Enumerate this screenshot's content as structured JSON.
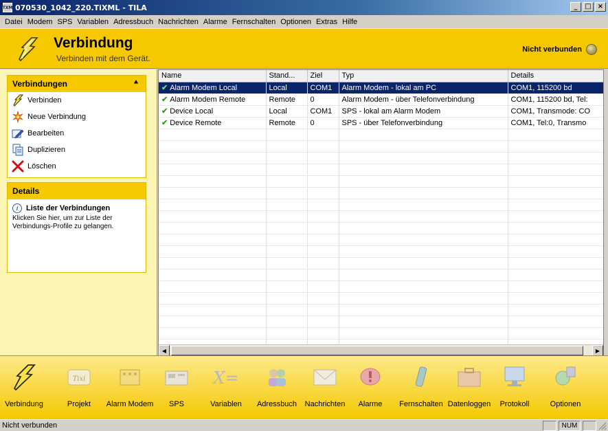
{
  "window": {
    "title": "070530_1042_220.TiXML - TILA",
    "app_icon_text": "TXM"
  },
  "menu": [
    "Datei",
    "Modem",
    "SPS",
    "Variablen",
    "Adressbuch",
    "Nachrichten",
    "Alarme",
    "Fernschalten",
    "Optionen",
    "Extras",
    "Hilfe"
  ],
  "header": {
    "title": "Verbindung",
    "subtitle": "Verbinden mit dem Gerät.",
    "status": "Nicht verbunden"
  },
  "connections_panel": {
    "title": "Verbindungen",
    "items": [
      "Verbinden",
      "Neue Verbindung",
      "Bearbeiten",
      "Duplizieren",
      "Löschen"
    ]
  },
  "details_panel": {
    "title": "Details",
    "info_title": "Liste der Verbindungen",
    "info_text": "Klicken Sie hier, um zur Liste der Verbindungs-Profile zu gelangen."
  },
  "table": {
    "columns": [
      "Name",
      "Stand...",
      "Ziel",
      "Typ",
      "Details"
    ],
    "rows": [
      {
        "name": "Alarm Modem Local",
        "stand": "Local",
        "ziel": "COM1",
        "typ": "Alarm Modem - lokal am PC",
        "details": "COM1, 115200 bd",
        "selected": true
      },
      {
        "name": "Alarm Modem Remote",
        "stand": "Remote",
        "ziel": "0",
        "typ": "Alarm Modem - über Telefonverbindung",
        "details": "COM1, 115200 bd, Tel:",
        "selected": false
      },
      {
        "name": "Device Local",
        "stand": "Local",
        "ziel": "COM1",
        "typ": "SPS - lokal am Alarm Modem",
        "details": "COM1, Transmode: CO",
        "selected": false
      },
      {
        "name": "Device Remote",
        "stand": "Remote",
        "ziel": "0",
        "typ": "SPS - über Telefonverbindung",
        "details": "COM1, Tel:0, Transmo",
        "selected": false
      }
    ]
  },
  "toolbar": {
    "buttons": [
      {
        "label": "Verbindung",
        "icon": "lightning-icon"
      },
      {
        "label": "Projekt",
        "icon": "tixi-device-icon",
        "icon_text": "Tixi"
      },
      {
        "label": "Alarm Modem",
        "icon": "alarm-modem-icon"
      },
      {
        "label": "SPS",
        "icon": "plc-icon"
      },
      {
        "label": "Variablen",
        "icon": "variable-icon",
        "icon_text": "X="
      },
      {
        "label": "Adressbuch",
        "icon": "address-book-icon"
      },
      {
        "label": "Nachrichten",
        "icon": "envelope-icon"
      },
      {
        "label": "Alarme",
        "icon": "alarm-icon"
      },
      {
        "label": "Fernschalten",
        "icon": "remote-switch-icon"
      },
      {
        "label": "Datenloggen",
        "icon": "briefcase-icon"
      },
      {
        "label": "Protokoll",
        "icon": "monitor-icon"
      },
      {
        "label": "Optionen",
        "icon": "options-icon"
      }
    ]
  },
  "statusbar": {
    "text": "Nicht verbunden",
    "num": "NUM"
  },
  "colors": {
    "accent": "#f5c800",
    "selection": "#0a246a",
    "panel_bg": "#fdf5b5"
  }
}
